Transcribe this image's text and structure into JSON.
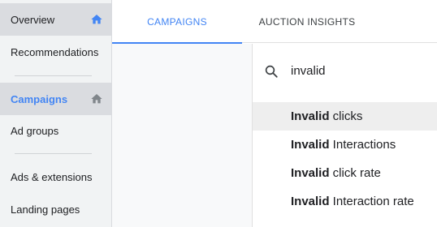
{
  "sidebar": {
    "items": [
      {
        "label": "Overview",
        "icon": "home-icon"
      },
      {
        "label": "Recommendations"
      },
      {
        "label": "Campaigns",
        "icon": "home-icon"
      },
      {
        "label": "Ad groups"
      },
      {
        "label": "Ads & extensions"
      },
      {
        "label": "Landing pages"
      }
    ]
  },
  "tabs": [
    {
      "label": "CAMPAIGNS",
      "active": true
    },
    {
      "label": "AUCTION INSIGHTS",
      "active": false
    }
  ],
  "search": {
    "query": "invalid",
    "results": [
      {
        "match": "Invalid",
        "rest": " clicks"
      },
      {
        "match": "Invalid",
        "rest": " Interactions"
      },
      {
        "match": "Invalid",
        "rest": " click rate"
      },
      {
        "match": "Invalid",
        "rest": " Interaction rate"
      }
    ]
  },
  "colors": {
    "accent": "#4285f4",
    "sidebar_bg": "#f1f3f4",
    "selected_bg": "#dadce0"
  }
}
